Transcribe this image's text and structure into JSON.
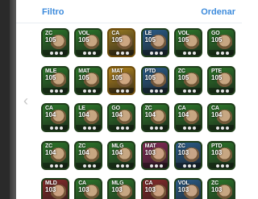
{
  "header": {
    "filter_label": "Filtro",
    "sort_label": "Ordenar"
  },
  "icons": {
    "prev": "chevron-left-icon"
  },
  "colors": {
    "accent": "#3d8bdc",
    "card_green": "#2f6b2a",
    "card_gold": "#b9891e",
    "card_dark": "#1e3f6b"
  },
  "cards": [
    {
      "pos": "ZC",
      "ovr": "105",
      "color": "#2d7a2a"
    },
    {
      "pos": "VOL",
      "ovr": "105",
      "color": "#2d7a2a"
    },
    {
      "pos": "CA",
      "ovr": "105",
      "color": "#9a7a22"
    },
    {
      "pos": "LE",
      "ovr": "105",
      "color": "#2b5f8d"
    },
    {
      "pos": "VOL",
      "ovr": "105",
      "color": "#2d7a2a"
    },
    {
      "pos": "GO",
      "ovr": "105",
      "color": "#2d7a2a"
    },
    {
      "pos": "MLE",
      "ovr": "105",
      "color": "#2d7a2a"
    },
    {
      "pos": "MAT",
      "ovr": "105",
      "color": "#2d7a2a"
    },
    {
      "pos": "MAT",
      "ovr": "105",
      "color": "#b9891e"
    },
    {
      "pos": "PTD",
      "ovr": "105",
      "color": "#2b5f8d"
    },
    {
      "pos": "ZC",
      "ovr": "105",
      "color": "#2d7a2a"
    },
    {
      "pos": "PTE",
      "ovr": "105",
      "color": "#2d7a2a"
    },
    {
      "pos": "CA",
      "ovr": "104",
      "color": "#2d7a2a"
    },
    {
      "pos": "LE",
      "ovr": "104",
      "color": "#2d7a2a"
    },
    {
      "pos": "GO",
      "ovr": "104",
      "color": "#2d7a2a"
    },
    {
      "pos": "ZC",
      "ovr": "104",
      "color": "#2d7a2a"
    },
    {
      "pos": "CA",
      "ovr": "104",
      "color": "#2d7a2a"
    },
    {
      "pos": "CA",
      "ovr": "104",
      "color": "#2d7a2a"
    },
    {
      "pos": "ZC",
      "ovr": "104",
      "color": "#2d7a2a"
    },
    {
      "pos": "ZC",
      "ovr": "104",
      "color": "#2d7a2a"
    },
    {
      "pos": "MLG",
      "ovr": "104",
      "color": "#2d7a2a"
    },
    {
      "pos": "MAT",
      "ovr": "103",
      "color": "#8a2b5a"
    },
    {
      "pos": "ZC",
      "ovr": "103",
      "color": "#2b5f8d"
    },
    {
      "pos": "PTD",
      "ovr": "103",
      "color": "#2d7a2a"
    },
    {
      "pos": "MLD",
      "ovr": "103",
      "color": "#8a2b2b"
    },
    {
      "pos": "CA",
      "ovr": "103",
      "color": "#2d7a2a"
    },
    {
      "pos": "MLG",
      "ovr": "103",
      "color": "#2d7a2a"
    },
    {
      "pos": "CA",
      "ovr": "103",
      "color": "#8a2b2b"
    },
    {
      "pos": "VOL",
      "ovr": "103",
      "color": "#2b5f8d"
    },
    {
      "pos": "ZC",
      "ovr": "103",
      "color": "#2d7a2a"
    }
  ]
}
